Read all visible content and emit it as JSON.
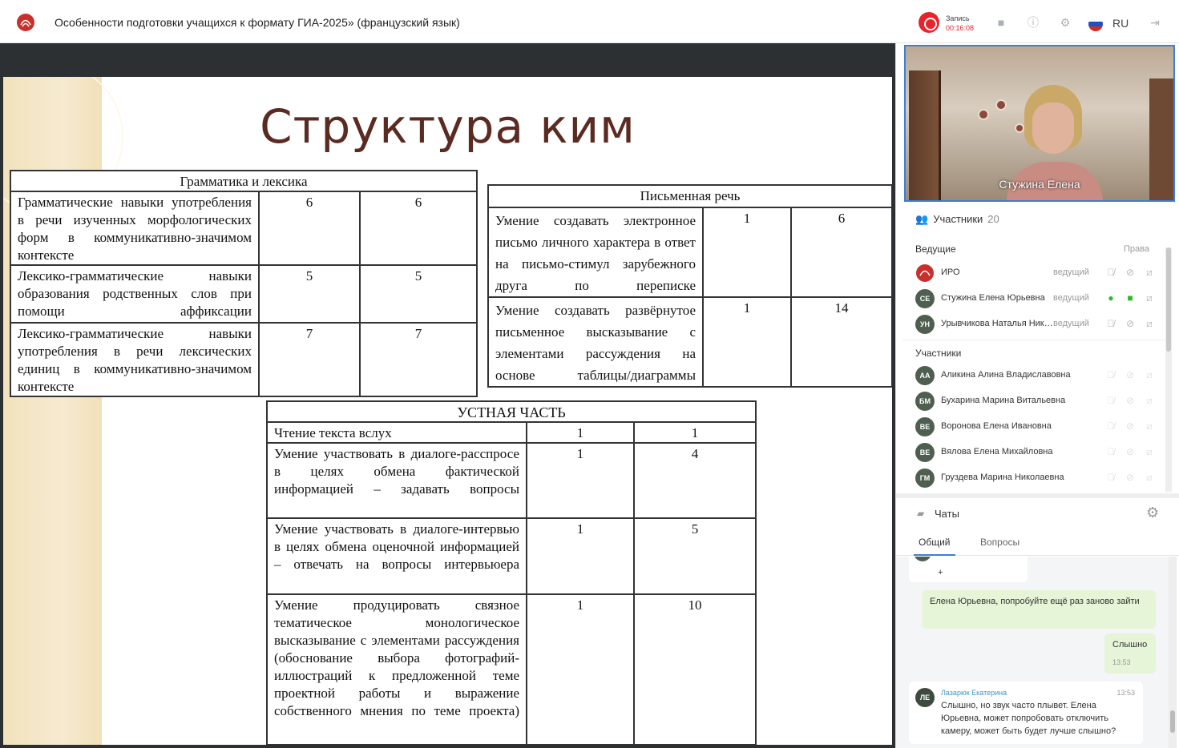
{
  "header": {
    "title": "Особенности подготовки учащихся к формату ГИА-2025» (французский язык)",
    "rec_label": "Запись",
    "rec_time": "00:16:08",
    "lang": "RU"
  },
  "slide": {
    "title": "Структура ким",
    "t1": {
      "header": "Грамматика и лексика",
      "rows": [
        {
          "text": "Грамматические навыки употребления в речи изученных морфологических форм в коммуникативно-значимом контексте",
          "a": "6",
          "b": "6"
        },
        {
          "text": "Лексико-грамматические навыки образования родственных слов при помощи аффиксации",
          "a": "5",
          "b": "5"
        },
        {
          "text": "Лексико-грамматические навыки употребления в речи лексических единиц в коммуникативно-значимом контексте",
          "a": "7",
          "b": "7"
        }
      ]
    },
    "t2": {
      "header": "Письменная речь",
      "rows": [
        {
          "text": "Умение создавать электронное письмо личного характера в ответ на письмо-стимул зарубежного друга по переписке",
          "a": "1",
          "b": "6"
        },
        {
          "text": "Умение создавать развёрнутое письменное высказывание с элементами рассуждения на основе таблицы/диаграммы",
          "a": "1",
          "b": "14"
        }
      ]
    },
    "t3": {
      "header": "УСТНАЯ ЧАСТЬ",
      "rows": [
        {
          "text": "Чтение текста вслух",
          "a": "1",
          "b": "1"
        },
        {
          "text": "Умение участвовать в диалоге-расспросе в целях обмена фактической информацией – задавать вопросы",
          "a": "1",
          "b": "4"
        },
        {
          "text": "Умение участвовать в диалоге-интервью в целях обмена оценочной информацией – отвечать на вопросы интервьюера",
          "a": "1",
          "b": "5"
        },
        {
          "text": "Умение продуцировать связное тематическое монологическое высказывание с элементами рассуждения (обоснование выбора фотографий-иллюстраций к предложенной теме проектной работы и выражение собственного мнения по теме проекта)",
          "a": "1",
          "b": "10"
        }
      ]
    }
  },
  "video": {
    "name": "Стужина Елена"
  },
  "participants": {
    "title": "Участники",
    "count": "20",
    "hosts_label": "Ведущие",
    "rights_label": "Права",
    "hosts": [
      {
        "initials": "",
        "name": "ИРО",
        "role": "ведущий"
      },
      {
        "initials": "СЕ",
        "name": "Стужина Елена Юрьевна",
        "role": "ведущий"
      },
      {
        "initials": "УН",
        "name": "Урывчикова Наталья Николаевна",
        "role": "ведущий"
      }
    ],
    "members_label": "Участники",
    "members": [
      {
        "initials": "АА",
        "name": "Аликина Алина Владиславовна"
      },
      {
        "initials": "БМ",
        "name": "Бухарина Марина Витальевна"
      },
      {
        "initials": "ВЕ",
        "name": "Воронова Елена Ивановна"
      },
      {
        "initials": "ВЕ",
        "name": "Вялова Елена Михайловна"
      },
      {
        "initials": "ГМ",
        "name": "Груздева Марина Николаевна"
      }
    ]
  },
  "chat": {
    "title": "Чаты",
    "tabs": [
      "Общий",
      "Вопросы"
    ],
    "messages": [
      {
        "avatar": "АА",
        "text": "+"
      },
      {
        "text": "Елена Юрьевна, попробуйте ещё раз заново зайти"
      },
      {
        "text": "Слышно",
        "time": "13:53"
      },
      {
        "avatar": "ЛЕ",
        "author": "Лазарюк Екатерина",
        "time": "13:53",
        "text": "Слышно, но звук часто плывет. Елена Юрьевна, может попробовать отключить камеру, может быть будет лучше слышно?"
      }
    ]
  },
  "colors": {
    "accent": "#3b7fd6",
    "rec": "#e5252a",
    "mic_on": "#2eb82e",
    "slide_title": "#5b2a20"
  }
}
